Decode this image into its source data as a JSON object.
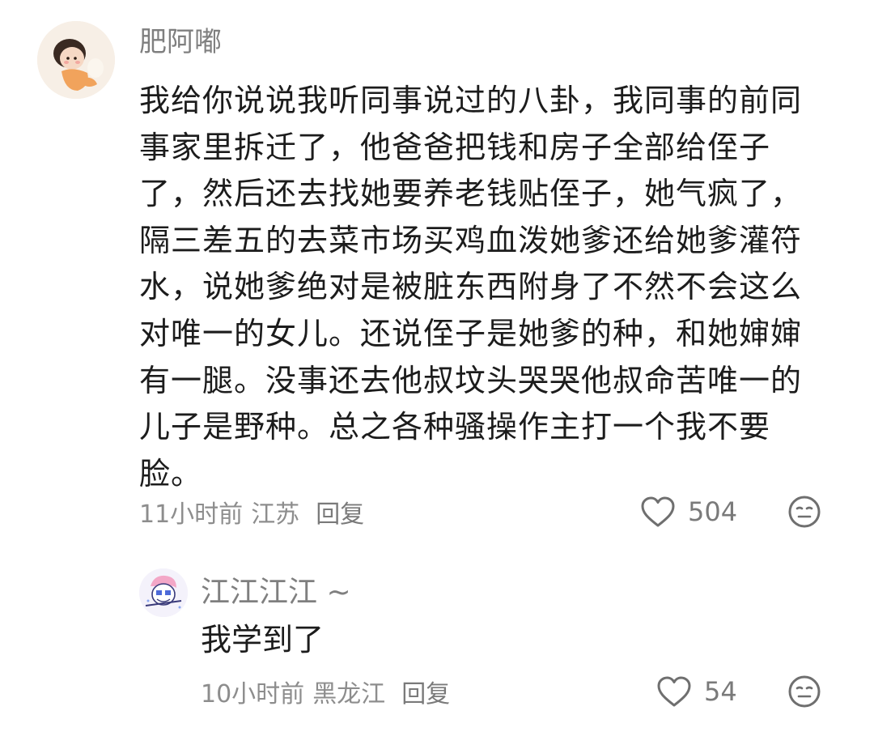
{
  "main_comment": {
    "username": "肥阿嘟",
    "content": "我给你说说我听同事说过的八卦，我同事的前同事家里拆迁了，他爸爸把钱和房子全部给侄子了，然后还去找她要养老钱贴侄子，她气疯了，隔三差五的去菜市场买鸡血泼她爹还给她爹灌符水，说她爹绝对是被脏东西附身了不然不会这么对唯一的女儿。还说侄子是她爹的种，和她婶婶有一腿。没事还去他叔坟头哭哭他叔命苦唯一的儿子是野种。总之各种骚操作主打一个我不要脸。",
    "time": "11小时前",
    "location": "江苏",
    "reply_label": "回复",
    "likes": "504",
    "like_icon": "heart-outline-icon",
    "reaction_icon": "neutral-face-icon"
  },
  "reply_comment": {
    "username": "江江江江 ~",
    "content": "我学到了",
    "time": "10小时前",
    "location": "黑龙江",
    "reply_label": "回复",
    "likes": "54",
    "like_icon": "heart-outline-icon",
    "reaction_icon": "neutral-face-icon"
  },
  "colors": {
    "background": "#ffffff",
    "text": "#1c1c1c",
    "secondary": "#8d8d8d",
    "icon": "#6f6f6f"
  }
}
